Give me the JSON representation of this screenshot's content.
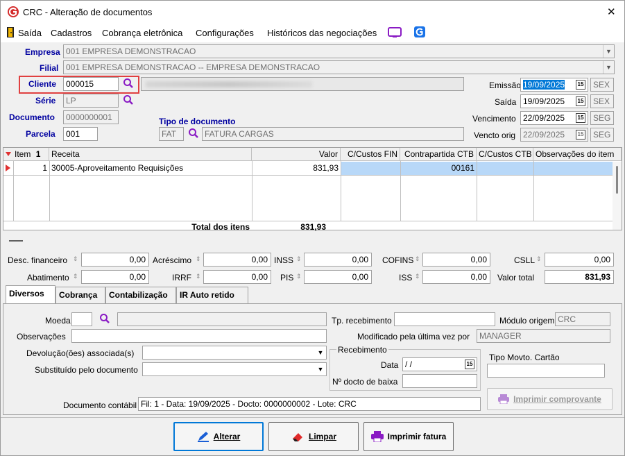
{
  "window": {
    "title": "CRC - Alteração de documentos",
    "close": "✕"
  },
  "menu": {
    "items": [
      "Saída",
      "Cadastros",
      "Cobrança eletrônica",
      "Configurações",
      "Históricos das negociações"
    ]
  },
  "header": {
    "empresa_label": "Empresa",
    "empresa_value": "001 EMPRESA DEMONSTRACAO",
    "filial_label": "Filial",
    "filial_value": "001 EMPRESA DEMONSTRACAO -- EMPRESA DEMONSTRACAO",
    "cliente_label": "Cliente",
    "cliente_value": "000015",
    "serie_label": "Série",
    "serie_value": "LP",
    "documento_label": "Documento",
    "documento_value": "0000000001",
    "parcela_label": "Parcela",
    "parcela_value": "001",
    "tipo_doc_label": "Tipo de documento",
    "tipo_doc_code": "FAT",
    "tipo_doc_desc": "FATURA CARGAS"
  },
  "dates": {
    "emissao_label": "Emissão",
    "emissao_value": "19/09/2025",
    "emissao_day": "SEX",
    "saida_label": "Saída",
    "saida_value": "19/09/2025",
    "saida_day": "SEX",
    "vencimento_label": "Vencimento",
    "vencimento_value": "22/09/2025",
    "vencimento_day": "SEG",
    "vencto_orig_label": "Vencto orig",
    "vencto_orig_value": "22/09/2025",
    "vencto_orig_day": "SEG",
    "cal_glyph": "15"
  },
  "grid": {
    "columns": [
      "Item",
      "Receita",
      "Valor",
      "C/Custos FIN",
      "Contrapartida CTB",
      "C/Custos CTB",
      "Observações do item"
    ],
    "rows": [
      {
        "item": "1",
        "receita": "30005-Aproveitamento Requisições",
        "valor": "831,93",
        "ccustos_fin": "",
        "contrapartida": "00161",
        "ccustos_ctb": "",
        "obs": ""
      }
    ],
    "total_label": "Total dos itens",
    "total_value": "831,93",
    "sort_glyph": "1"
  },
  "totals": {
    "desc_fin_label": "Desc. financeiro",
    "desc_fin": "0,00",
    "acrescimo_label": "Acréscimo",
    "acrescimo": "0,00",
    "inss_label": "INSS",
    "inss": "0,00",
    "cofins_label": "COFINS",
    "cofins": "0,00",
    "csll_label": "CSLL",
    "csll": "0,00",
    "abatimento_label": "Abatimento",
    "abatimento": "0,00",
    "irrf_label": "IRRF",
    "irrf": "0,00",
    "pis_label": "PIS",
    "pis": "0,00",
    "iss_label": "ISS",
    "iss": "0,00",
    "valor_total_label": "Valor total",
    "valor_total": "831,93"
  },
  "tabs": [
    "Diversos",
    "Cobrança",
    "Contabilização",
    "IR Auto retido"
  ],
  "diversos": {
    "moeda_label": "Moeda",
    "observacoes_label": "Observações",
    "devolucoes_label": "Devolução(ões) associada(s)",
    "substituido_label": "Substituído pelo documento",
    "tp_recebimento_label": "Tp. recebimento",
    "modulo_origem_label": "Módulo origem",
    "modulo_origem_value": "CRC",
    "modificado_label": "Modificado pela última vez por",
    "modificado_value": "MANAGER",
    "recebimento_group": "Recebimento",
    "data_label": "Data",
    "data_value": "/ /",
    "docto_baixa_label": "Nº docto de baixa",
    "tipo_movto_label": "Tipo Movto. Cartão",
    "imprimir_comprovante": "Imprimir comprovante",
    "doc_contabil_label": "Documento contábil",
    "doc_contabil_value": "Fil: 1 - Data: 19/09/2025 - Docto: 0000000002 - Lote: CRC"
  },
  "buttons": {
    "alterar": "Alterar",
    "limpar": "Limpar",
    "imprimir_fatura": "Imprimir fatura"
  },
  "colors": {
    "accent": "#0078d7",
    "label_blue": "#0000a0",
    "highlight_red": "#e04040",
    "logo_red": "#d42a2a"
  }
}
